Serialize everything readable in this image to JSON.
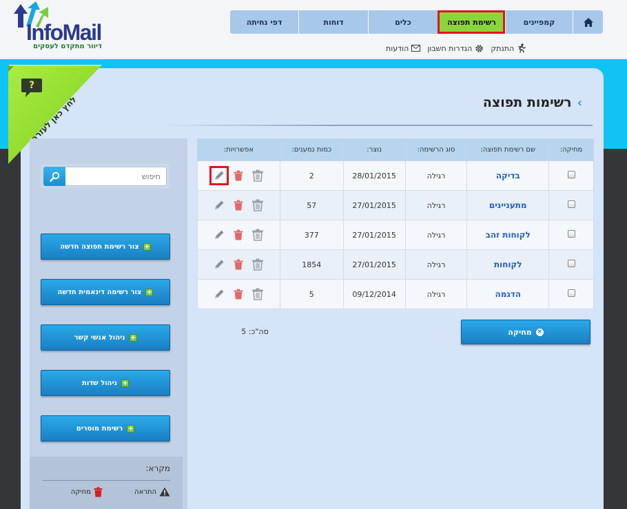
{
  "logo": {
    "brand_part1": "Info",
    "brand_part2": "Mail",
    "tagline": "דיוור מתקדם לעסקים"
  },
  "nav": {
    "tabs": [
      {
        "label": "קמפיינים"
      },
      {
        "label": "רשימת תפוצה"
      },
      {
        "label": "כלים"
      },
      {
        "label": "דוחות"
      },
      {
        "label": "דפי נחיתה"
      }
    ]
  },
  "subnav": {
    "messages": "הודעות",
    "account_settings": "הגדרות חשבון",
    "logout": "התנתק"
  },
  "help_ribbon": {
    "label": "לחץ כאן לעזרה",
    "badge": "?"
  },
  "page": {
    "title": "רשימות תפוצה"
  },
  "sidebar": {
    "search_placeholder": "חיפוש",
    "buttons": [
      {
        "label": "צור רשימת תפוצה חדשה"
      },
      {
        "label": "צור רשימה דינאמית חדשה"
      },
      {
        "label": "ניהול אנשי קשר"
      },
      {
        "label": "ניהול שדות"
      },
      {
        "label": "רשימת מוסרים"
      }
    ],
    "legend": {
      "title": "מקרא:",
      "warning": "התראה",
      "delete": "מחיקה"
    }
  },
  "table": {
    "headers": [
      "מחיקה:",
      "שם רשימת תפוצה:",
      "סוג הרשימה:",
      "נוצר:",
      "כמות נמענים:",
      "אפשרויות:"
    ],
    "rows": [
      {
        "name": "בדיקה",
        "type": "רגילה",
        "created": "28/01/2015",
        "count": "2"
      },
      {
        "name": "מתעניינים",
        "type": "רגילה",
        "created": "27/01/2015",
        "count": "57"
      },
      {
        "name": "לקוחות זהב",
        "type": "רגילה",
        "created": "27/01/2015",
        "count": "377"
      },
      {
        "name": "לקוחות",
        "type": "רגילה",
        "created": "27/01/2015",
        "count": "1854"
      },
      {
        "name": "הדגמה",
        "type": "רגילה",
        "created": "09/12/2014",
        "count": "5"
      }
    ],
    "delete_button": "מחיקה",
    "total": "סה\"כ: 5"
  },
  "colors": {
    "accent": "#10c3f5",
    "active_tab": "#8ad63a",
    "highlight": "#e0141c",
    "button": "#1a8fcf"
  }
}
